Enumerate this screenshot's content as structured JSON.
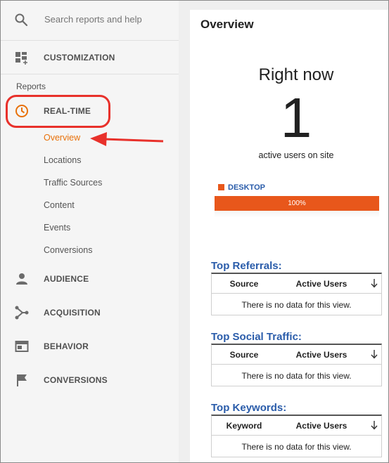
{
  "sidebar": {
    "search_placeholder": "Search reports and help",
    "customization": "CUSTOMIZATION",
    "reports_heading": "Reports",
    "realtime": "REAL-TIME",
    "realtime_items": [
      "Overview",
      "Locations",
      "Traffic Sources",
      "Content",
      "Events",
      "Conversions"
    ],
    "audience": "AUDIENCE",
    "acquisition": "ACQUISITION",
    "behavior": "BEHAVIOR",
    "conversions": "CONVERSIONS",
    "icons": {
      "search": "search-icon",
      "customization": "dashboard-plus-icon",
      "realtime": "clock-icon",
      "audience": "person-icon",
      "acquisition": "branch-icon",
      "behavior": "window-icon",
      "conversions": "flag-icon"
    }
  },
  "main": {
    "title": "Overview",
    "right_now_label": "Right now",
    "active_users": "1",
    "active_users_caption": "active users on site",
    "device": {
      "label": "DESKTOP",
      "percent_label": "100%",
      "share": 1.0
    },
    "sections": [
      {
        "title": "Top Referrals:",
        "col1": "Source",
        "col2": "Active Users",
        "empty": "There is no data for this view."
      },
      {
        "title": "Top Social Traffic:",
        "col1": "Source",
        "col2": "Active Users",
        "empty": "There is no data for this view."
      },
      {
        "title": "Top Keywords:",
        "col1": "Keyword",
        "col2": "Active Users",
        "empty": "There is no data for this view."
      }
    ]
  },
  "colors": {
    "accent_orange": "#e8710a",
    "bar_orange": "#e8571b",
    "highlight_red": "#e8312b",
    "link_blue": "#2a5caa"
  }
}
